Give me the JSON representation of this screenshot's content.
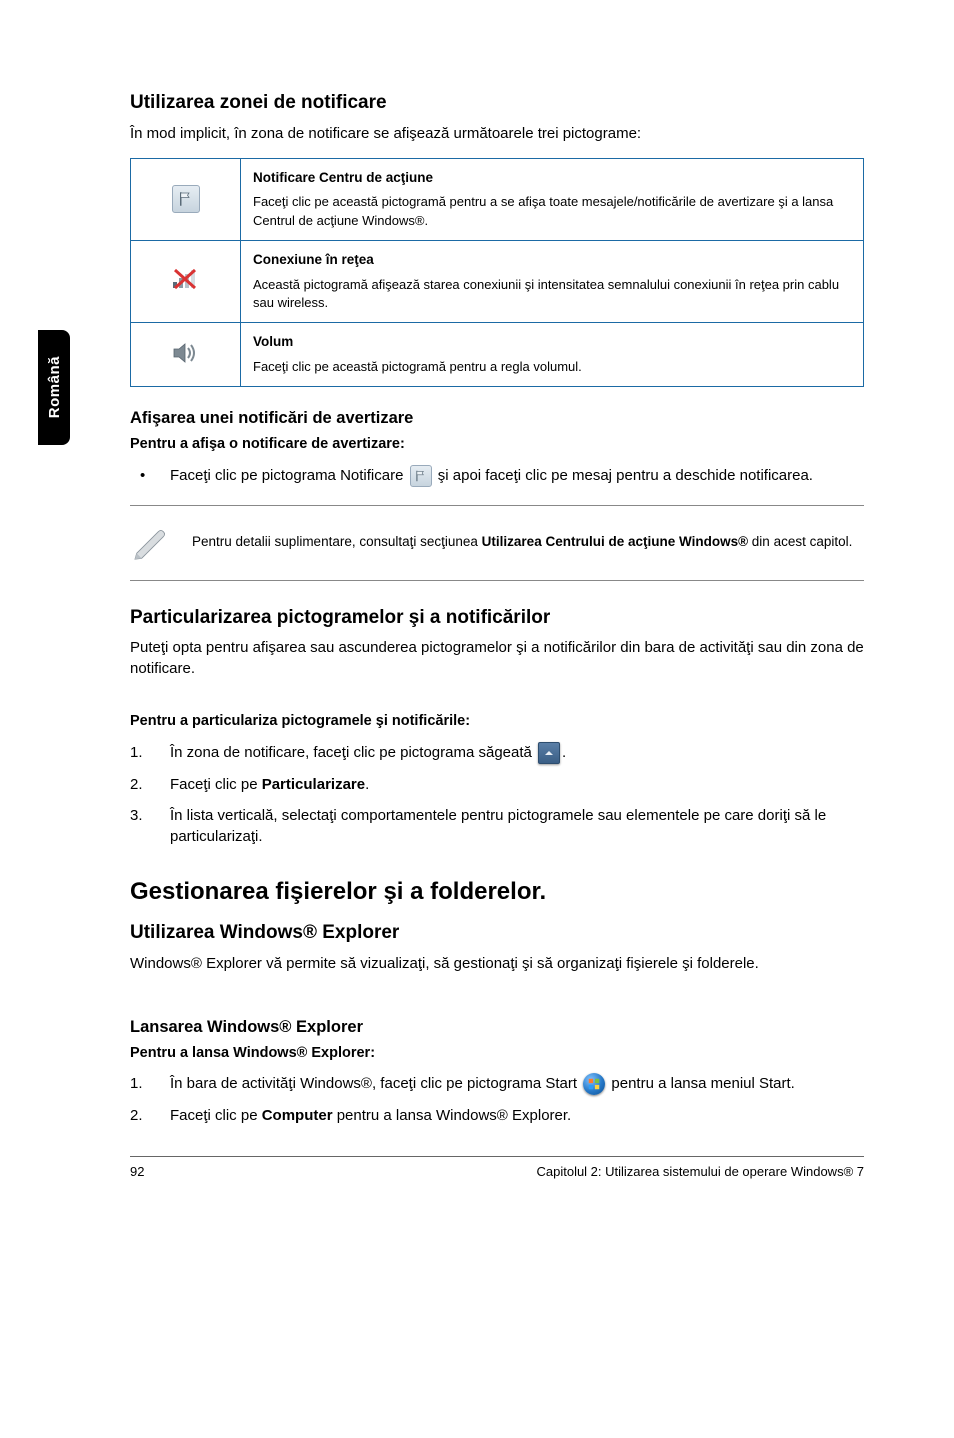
{
  "sideTab": "Română",
  "section1": {
    "title": "Utilizarea zonei de notificare",
    "intro": "În mod implicit, în zona de notificare se afişează următoarele trei pictograme:"
  },
  "table": {
    "rows": [
      {
        "icon": "flag-icon",
        "title": "Notificare Centru de acţiune",
        "desc": "Faceţi clic pe această pictogramă pentru a se afişa toate mesajele/notificările de avertizare şi a lansa Centrul de acţiune Windows®."
      },
      {
        "icon": "network-icon",
        "title": "Conexiune în reţea",
        "desc": "Această pictogramă afişează starea conexiunii şi intensitatea semnalului conexiunii în reţea prin cablu sau wireless."
      },
      {
        "icon": "volume-icon",
        "title": "Volum",
        "desc": "Faceţi clic pe această pictogramă pentru a regla volumul."
      }
    ]
  },
  "section2": {
    "title": "Afişarea unei notificări de avertizare",
    "subtitle": "Pentru a afişa o notificare de avertizare:",
    "bullet_pre": "Faceţi clic pe pictograma Notificare ",
    "bullet_post": " şi apoi faceţi clic pe mesaj pentru a deschide notificarea."
  },
  "note1": {
    "pre": "Pentru detalii suplimentare, consultaţi secţiunea ",
    "bold": "Utilizarea Centrului de acţiune Windows®",
    "post": " din acest capitol."
  },
  "section3": {
    "title": "Particularizarea pictogramelor şi a notificărilor",
    "intro": "Puteţi opta pentru afişarea sau ascunderea pictogramelor şi a notificărilor din bara de activităţi sau din zona de notificare.",
    "subtitle": "Pentru a particulariza pictogramele şi notificările:",
    "steps": [
      {
        "n": "1.",
        "text_pre": "În zona de notificare, faceţi clic pe pictograma săgeată ",
        "text_post": "."
      },
      {
        "n": "2.",
        "text_pre": "Faceţi clic pe ",
        "bold": "Particularizare",
        "text_post": "."
      },
      {
        "n": "3.",
        "text_pre": "În lista verticală, selectaţi comportamentele pentru pictogramele sau elementele pe care doriţi să le particularizaţi."
      }
    ]
  },
  "section4": {
    "major": "Gestionarea fişierelor şi a folderelor.",
    "subA_title": "Utilizarea Windows® Explorer",
    "subA_text": "Windows® Explorer vă permite să vizualizaţi, să gestionaţi şi să organizaţi fişierele şi folderele.",
    "subB_title": "Lansarea Windows® Explorer",
    "subB_subtitle": "Pentru a lansa Windows® Explorer:",
    "steps": [
      {
        "n": "1.",
        "pre": "În bara de activităţi Windows®, faceţi clic pe pictograma Start ",
        "post": " pentru a lansa meniul Start."
      },
      {
        "n": "2.",
        "pre": "Faceţi clic pe ",
        "bold": "Computer",
        "post": " pentru a lansa Windows® Explorer."
      }
    ]
  },
  "footer": {
    "page": "92",
    "chapter": "Capitolul 2: Utilizarea sistemului de operare Windows® 7"
  }
}
